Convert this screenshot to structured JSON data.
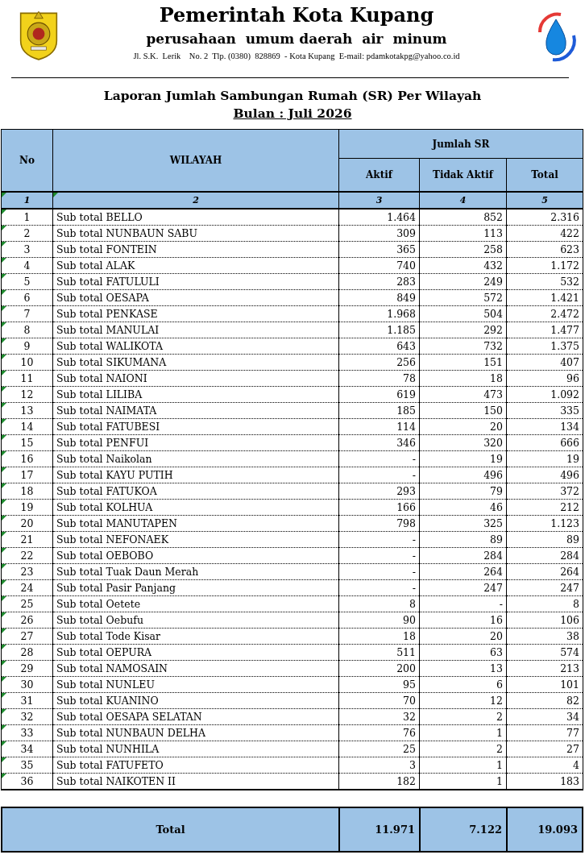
{
  "letterhead": {
    "title": "Pemerintah Kota Kupang",
    "subtitle": "perusahaan  umum daerah  air  minum",
    "address": "Jl. S.K.  Lerik    No. 2  Tlp. (0380)  828869  - Kota Kupang  E-mail: pdamkotakpg@yahoo.co.id"
  },
  "report": {
    "title": "Laporan Jumlah Sambungan Rumah (SR) Per Wilayah",
    "period": "Bulan : Juli 2026"
  },
  "table": {
    "columns": [
      "No",
      "WILAYAH"
    ],
    "group_header": "Jumlah SR",
    "sub_columns": [
      "Aktif",
      "Tidak Aktif",
      "Total"
    ],
    "column_numbers": [
      "1",
      "2",
      "3",
      "4",
      "5"
    ],
    "rows": [
      {
        "no": "1",
        "wilayah": "Sub total BELLO",
        "aktif": "1.464",
        "tidak_aktif": "852",
        "total": "2.316"
      },
      {
        "no": "2",
        "wilayah": "Sub total NUNBAUN SABU",
        "aktif": "309",
        "tidak_aktif": "113",
        "total": "422"
      },
      {
        "no": "3",
        "wilayah": "Sub total FONTEIN",
        "aktif": "365",
        "tidak_aktif": "258",
        "total": "623"
      },
      {
        "no": "4",
        "wilayah": "Sub total ALAK",
        "aktif": "740",
        "tidak_aktif": "432",
        "total": "1.172"
      },
      {
        "no": "5",
        "wilayah": "Sub total FATULULI",
        "aktif": "283",
        "tidak_aktif": "249",
        "total": "532"
      },
      {
        "no": "6",
        "wilayah": "Sub total OESAPA",
        "aktif": "849",
        "tidak_aktif": "572",
        "total": "1.421"
      },
      {
        "no": "7",
        "wilayah": "Sub total PENKASE",
        "aktif": "1.968",
        "tidak_aktif": "504",
        "total": "2.472"
      },
      {
        "no": "8",
        "wilayah": "Sub total MANULAI",
        "aktif": "1.185",
        "tidak_aktif": "292",
        "total": "1.477"
      },
      {
        "no": "9",
        "wilayah": "Sub total WALIKOTA",
        "aktif": "643",
        "tidak_aktif": "732",
        "total": "1.375"
      },
      {
        "no": "10",
        "wilayah": "Sub total SIKUMANA",
        "aktif": "256",
        "tidak_aktif": "151",
        "total": "407"
      },
      {
        "no": "11",
        "wilayah": "Sub total NAIONI",
        "aktif": "78",
        "tidak_aktif": "18",
        "total": "96"
      },
      {
        "no": "12",
        "wilayah": "Sub total LILIBA",
        "aktif": "619",
        "tidak_aktif": "473",
        "total": "1.092"
      },
      {
        "no": "13",
        "wilayah": "Sub total NAIMATA",
        "aktif": "185",
        "tidak_aktif": "150",
        "total": "335"
      },
      {
        "no": "14",
        "wilayah": "Sub total FATUBESI",
        "aktif": "114",
        "tidak_aktif": "20",
        "total": "134"
      },
      {
        "no": "15",
        "wilayah": "Sub total PENFUI",
        "aktif": "346",
        "tidak_aktif": "320",
        "total": "666"
      },
      {
        "no": "16",
        "wilayah": "Sub total Naikolan",
        "aktif": "-",
        "tidak_aktif": "19",
        "total": "19"
      },
      {
        "no": "17",
        "wilayah": "Sub total KAYU PUTIH",
        "aktif": "-",
        "tidak_aktif": "496",
        "total": "496"
      },
      {
        "no": "18",
        "wilayah": "Sub total FATUKOA",
        "aktif": "293",
        "tidak_aktif": "79",
        "total": "372"
      },
      {
        "no": "19",
        "wilayah": "Sub total KOLHUA",
        "aktif": "166",
        "tidak_aktif": "46",
        "total": "212"
      },
      {
        "no": "20",
        "wilayah": "Sub total MANUTAPEN",
        "aktif": "798",
        "tidak_aktif": "325",
        "total": "1.123"
      },
      {
        "no": "21",
        "wilayah": "Sub total NEFONAEK",
        "aktif": "-",
        "tidak_aktif": "89",
        "total": "89"
      },
      {
        "no": "22",
        "wilayah": "Sub total OEBOBO",
        "aktif": "-",
        "tidak_aktif": "284",
        "total": "284"
      },
      {
        "no": "23",
        "wilayah": "Sub total Tuak Daun Merah",
        "aktif": "-",
        "tidak_aktif": "264",
        "total": "264"
      },
      {
        "no": "24",
        "wilayah": "Sub total Pasir Panjang",
        "aktif": "-",
        "tidak_aktif": "247",
        "total": "247"
      },
      {
        "no": "25",
        "wilayah": "Sub total Oetete",
        "aktif": "8",
        "tidak_aktif": "-",
        "total": "8"
      },
      {
        "no": "26",
        "wilayah": "Sub total Oebufu",
        "aktif": "90",
        "tidak_aktif": "16",
        "total": "106"
      },
      {
        "no": "27",
        "wilayah": "Sub total Tode Kisar",
        "aktif": "18",
        "tidak_aktif": "20",
        "total": "38"
      },
      {
        "no": "28",
        "wilayah": "Sub total OEPURA",
        "aktif": "511",
        "tidak_aktif": "63",
        "total": "574"
      },
      {
        "no": "29",
        "wilayah": "Sub total NAMOSAIN",
        "aktif": "200",
        "tidak_aktif": "13",
        "total": "213"
      },
      {
        "no": "30",
        "wilayah": "Sub total NUNLEU",
        "aktif": "95",
        "tidak_aktif": "6",
        "total": "101"
      },
      {
        "no": "31",
        "wilayah": "Sub total KUANINO",
        "aktif": "70",
        "tidak_aktif": "12",
        "total": "82"
      },
      {
        "no": "32",
        "wilayah": "Sub total OESAPA SELATAN",
        "aktif": "32",
        "tidak_aktif": "2",
        "total": "34"
      },
      {
        "no": "33",
        "wilayah": "Sub total NUNBAUN DELHA",
        "aktif": "76",
        "tidak_aktif": "1",
        "total": "77"
      },
      {
        "no": "34",
        "wilayah": "Sub total NUNHILA",
        "aktif": "25",
        "tidak_aktif": "2",
        "total": "27"
      },
      {
        "no": "35",
        "wilayah": "Sub total FATUFETO",
        "aktif": "3",
        "tidak_aktif": "1",
        "total": "4"
      },
      {
        "no": "36",
        "wilayah": "Sub total NAIKOTEN II",
        "aktif": "182",
        "tidak_aktif": "1",
        "total": "183"
      }
    ],
    "total_row": {
      "label": "Total",
      "aktif": "11.971",
      "tidak_aktif": "7.122",
      "total": "19.093"
    }
  }
}
